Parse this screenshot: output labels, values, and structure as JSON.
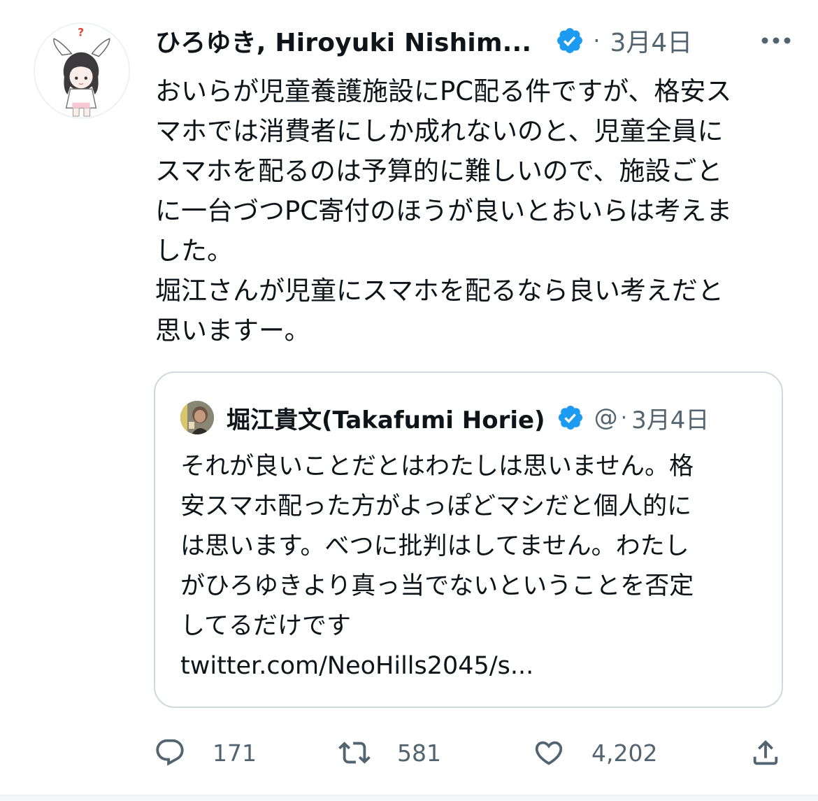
{
  "tweet": {
    "author_name": "ひろゆき, Hiroyuki Nishim...",
    "separator": "·",
    "date": "3月4日",
    "body_lines": [
      "おいらが児童養護施設にPC配る件ですが、格安ス",
      "マホでは消費者にしか成れないのと、児童全員に",
      "スマホを配るのは予算的に難しいので、施設ごと",
      "に一台づつPC寄付のほうが良いとおいらは考えま",
      "した。",
      "堀江さんが児童にスマホを配るなら良い考えだと",
      "思いますー。"
    ]
  },
  "quote": {
    "author_name": "堀江貴文(Takafumi Horie)",
    "handle": "@",
    "separator": "·",
    "date": "3月4日",
    "body_lines": [
      "それが良いことだとはわたしは思いません。格",
      "安スマホ配った方がよっぽどマシだと個人的に",
      "は思います。べつに批判はしてません。わたし",
      "がひろゆきより真っ当でないということを否定",
      "してるだけです",
      "twitter.com/NeoHills2045/s..."
    ]
  },
  "actions": {
    "reply_count": "171",
    "retweet_count": "581",
    "like_count": "4,202"
  },
  "colors": {
    "verified": "#1d9bf0",
    "text": "#0f1419",
    "secondary": "#536471",
    "border": "#cfd9de"
  }
}
